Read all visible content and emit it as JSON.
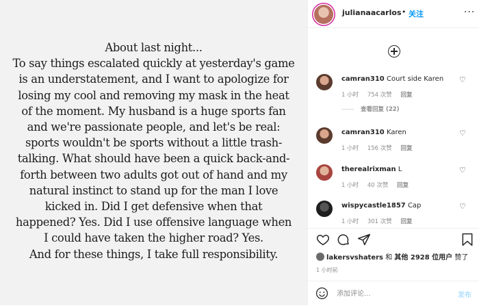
{
  "post": {
    "lines": [
      "About last night...",
      "To say things escalated quickly at yesterday's game",
      "is an understatement, and I want to apologize for",
      "losing my cool and removing my mask in the heat",
      "of the moment. My husband is a huge sports fan",
      "and we're passionate people, and let's be real:",
      "sports wouldn't be sports without a little trash-",
      "talking. What should have been a quick back-and-",
      "forth between two adults got out of hand and my",
      "natural instinct to stand up for the man I love",
      "kicked in. Did I get defensive when that",
      "happened? Yes. Did I use offensive language when",
      "I could have taken the higher road? Yes.",
      "And for these things, I take full responsibility."
    ]
  },
  "header": {
    "username": "julianaacarlos",
    "dot": "•",
    "follow_label": "关注",
    "more_icon": "more-horizontal-icon",
    "more_glyph": "···"
  },
  "comments": [
    {
      "username": "camran310",
      "text": "Court side Karen",
      "time": "1 小时",
      "likes": "754 次赞",
      "reply": "回复",
      "view_replies": "查看回复 (22)",
      "avatar_color": "#7a4a3a"
    },
    {
      "username": "camran310",
      "text": "Karen",
      "time": "1 小时",
      "likes": "156 次赞",
      "reply": "回复",
      "avatar_color": "#7a4a3a"
    },
    {
      "username": "therealrixman",
      "text": "L",
      "time": "1 小时",
      "likes": "40 次赞",
      "reply": "回复",
      "avatar_color": "#b04a4a"
    },
    {
      "username": "wispycastle1857",
      "text": "Cap",
      "time": "1 小时",
      "likes": "301 次赞",
      "reply": "回复",
      "avatar_color": "#2a2a2a"
    }
  ],
  "actions": {
    "liked_by_user": "lakersvshaters",
    "liked_and": "和",
    "liked_others": "其他 2928 位用户",
    "liked_suffix": "赞了",
    "time_ago": "1 小时前"
  },
  "comment_box": {
    "placeholder": "添加评论...",
    "post_label": "发布"
  },
  "colors": {
    "accent": "#0095f6",
    "post_disabled": "#b2dffc",
    "image_bg": "#f2f2f2"
  }
}
